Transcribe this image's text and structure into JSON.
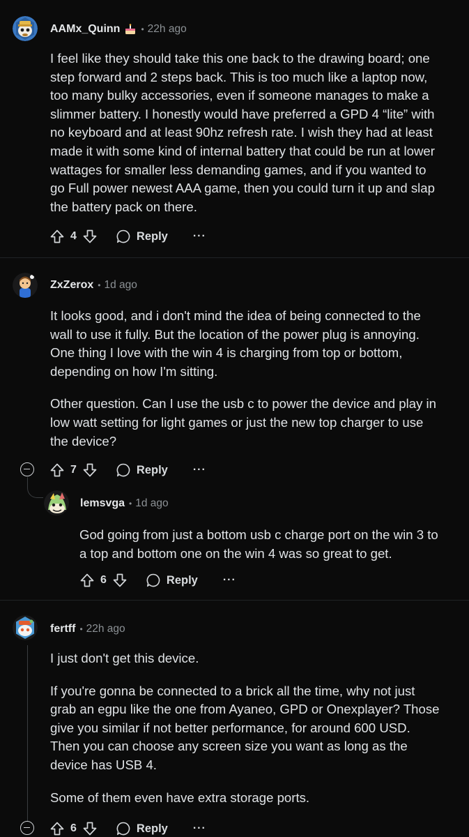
{
  "comments": [
    {
      "author": "AAMx_Quinn",
      "separator": "•",
      "time": "22h ago",
      "flair": "cake-icon",
      "paragraphs": [
        "I feel like they should take this one back to the drawing board; one step forward and 2 steps back. This is too much like a laptop now, too many bulky accessories, even if someone manages to make a slimmer battery. I honestly would have preferred a GPD 4 “lite” with no keyboard and at least 90hz refresh rate. I wish they had at least made it with some kind of internal battery that could be run at lower wattages for smaller less demanding games, and if you wanted to go Full power newest AAA game, then you could turn it up and slap the battery pack on there."
      ],
      "score": "4",
      "reply_label": "Reply",
      "more_label": "···"
    },
    {
      "author": "ZxZerox",
      "separator": "•",
      "time": "1d ago",
      "paragraphs": [
        "It looks good, and i don't mind the idea of being connected to the wall to use it fully. But the location of the power plug is annoying. One thing I love with the win 4 is charging from top or bottom, depending on how I'm sitting.",
        "Other question. Can I use the usb c to power the device and play in low watt setting for light games or just the new top charger to use the device?"
      ],
      "score": "7",
      "reply_label": "Reply",
      "more_label": "···"
    },
    {
      "author": "lemsvga",
      "separator": "•",
      "time": "1d ago",
      "paragraphs": [
        "God going from just a bottom usb c charge port on the win 3 to a top and bottom one on the win 4 was so great to get."
      ],
      "score": "6",
      "reply_label": "Reply",
      "more_label": "···"
    },
    {
      "author": "fertff",
      "separator": "•",
      "time": "22h ago",
      "paragraphs": [
        "I just don't get this device.",
        "If you're gonna be connected to a brick all the time, why not just grab an egpu like the one from Ayaneo, GPD or Onexplayer? Those give you similar if not better performance, for around 600 USD. Then you can choose any screen size you want as long as the device has USB 4.",
        "Some of them even have extra storage ports."
      ],
      "score": "6",
      "reply_label": "Reply",
      "more_label": "···"
    }
  ]
}
